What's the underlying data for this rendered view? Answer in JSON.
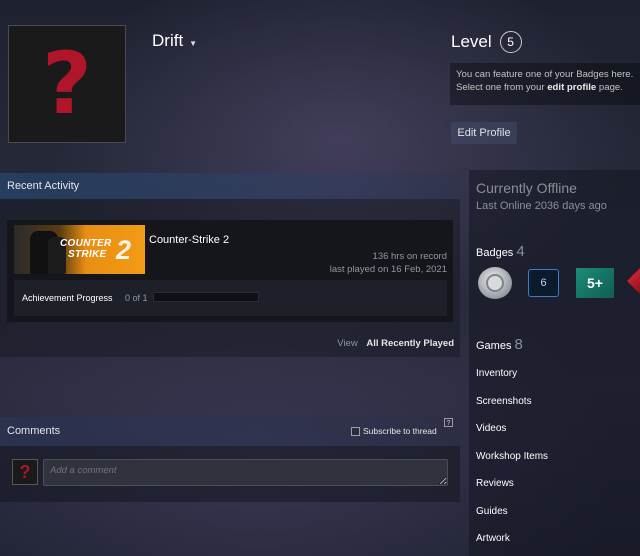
{
  "profile": {
    "persona_name": "Drift",
    "avatar_glyph": "?",
    "level_label": "Level",
    "level_value": "5",
    "feature_text_1": "You can feature one of your Badges here.",
    "feature_text_2a": "Select one from your",
    "feature_link": "edit profile",
    "feature_text_2b": "page.",
    "edit_profile_label": "Edit Profile"
  },
  "recent_activity": {
    "title": "Recent Activity",
    "game": {
      "name": "Counter-Strike 2",
      "thumb_logo_line1": "COUNTER",
      "thumb_logo_line2": "STRIKE",
      "thumb_logo_number": "2",
      "hours": "136 hrs on record",
      "last_played": "last played on 16 Feb, 2021",
      "achievement_label": "Achievement Progress",
      "achievement_count": "0 of 1",
      "achievement_progress": 0
    },
    "view_label": "View",
    "view_link": "All Recently Played"
  },
  "comments": {
    "title": "Comments",
    "subscribe_label": "Subscribe to thread",
    "help_glyph": "?",
    "avatar_glyph": "?",
    "placeholder": "Add a comment"
  },
  "sidebar": {
    "status": "Currently Offline",
    "last_online": "Last Online 2036 days ago",
    "badges_label": "Badges",
    "badges_count": "4",
    "badges": [
      {
        "name": "coin-badge-icon"
      },
      {
        "name": "years-badge-icon",
        "text": "6"
      },
      {
        "name": "five-plus-badge-icon",
        "text": "5+"
      },
      {
        "name": "red-badge-icon"
      }
    ],
    "games_label": "Games",
    "games_count": "8",
    "links": [
      "Inventory",
      "Screenshots",
      "Videos",
      "Workshop Items",
      "Reviews",
      "Guides",
      "Artwork"
    ]
  },
  "colors": {
    "accent": "#c7d5e0",
    "avatar_mark": "#b0152a",
    "badge_teal": "#1d8c7a",
    "badge_blue": "#3a7cc7"
  }
}
